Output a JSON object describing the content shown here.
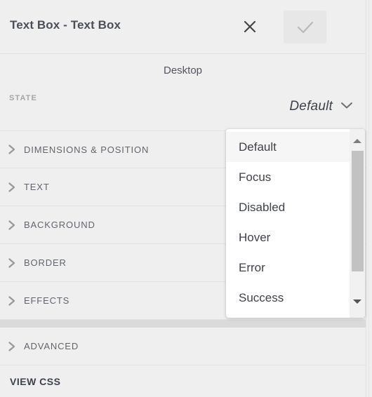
{
  "header": {
    "title": "Text Box - Text Box",
    "close_icon": "close-icon",
    "confirm_icon": "check-icon"
  },
  "device": {
    "label": "Desktop"
  },
  "state": {
    "label": "STATE",
    "value": "Default",
    "chevron_icon": "chevron-down-icon"
  },
  "accordion": {
    "sections": [
      {
        "label": "DIMENSIONS & POSITION",
        "icon": "chevron-right-icon"
      },
      {
        "label": "TEXT",
        "icon": "chevron-right-icon"
      },
      {
        "label": "BACKGROUND",
        "icon": "chevron-right-icon"
      },
      {
        "label": "BORDER",
        "icon": "chevron-right-icon"
      },
      {
        "label": "EFFECTS",
        "icon": "chevron-right-icon"
      }
    ],
    "advanced": {
      "label": "ADVANCED",
      "icon": "chevron-right-icon"
    },
    "view_css": {
      "label": "VIEW CSS"
    }
  },
  "dropdown": {
    "open": true,
    "selected": "Default",
    "options": [
      {
        "label": "Default"
      },
      {
        "label": "Focus"
      },
      {
        "label": "Disabled"
      },
      {
        "label": "Hover"
      },
      {
        "label": "Error"
      },
      {
        "label": "Success"
      }
    ],
    "scrollbar": {
      "up_icon": "scroll-up-arrow-icon",
      "down_icon": "scroll-down-arrow-icon"
    }
  },
  "colors": {
    "panel_bg": "#efefef",
    "divider": "#e3e3e3",
    "text_primary": "#3f424b",
    "text_muted": "#63656d",
    "label_muted": "#a6a6a6",
    "dropdown_bg": "#ffffff",
    "dropdown_selected_bg": "#f6f6f6",
    "scroll_thumb": "#c2c2c2",
    "separator_band": "#dadada"
  }
}
